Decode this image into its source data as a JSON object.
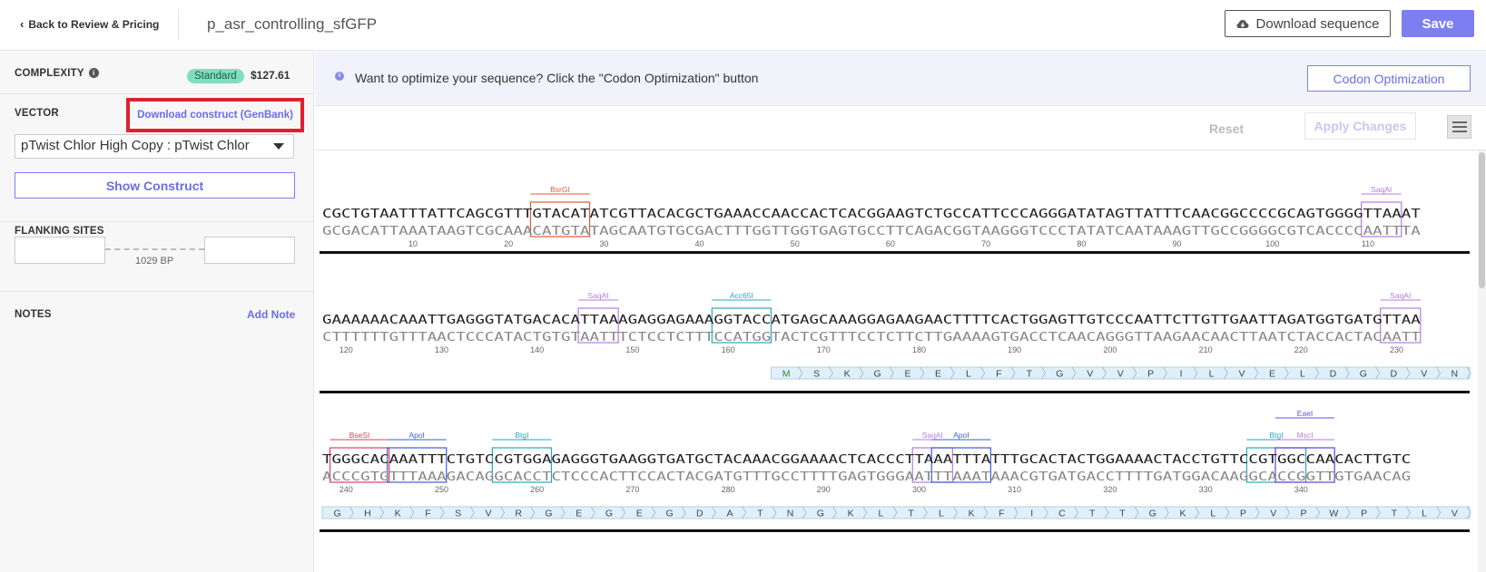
{
  "header": {
    "back_label": "Back to Review & Pricing",
    "sequence_name": "p_asr_controlling_sfGFP",
    "download_label": "Download sequence",
    "save_label": "Save"
  },
  "sidebar": {
    "complexity_label": "COMPLEXITY",
    "complexity_badge": "Standard",
    "price": "$127.61",
    "vector_label": "VECTOR",
    "genbank_link": "Download construct (GenBank)",
    "vector_value": "pTwist Chlor High Copy : pTwist Chlor",
    "show_construct": "Show Construct",
    "flanking_label": "FLANKING SITES",
    "flanking_length": "1029 BP",
    "notes_label": "NOTES",
    "add_note": "Add Note"
  },
  "main": {
    "banner_text": "Want to optimize your sequence? Click the \"Codon Optimization\" button",
    "codon_button": "Codon Optimization",
    "reset": "Reset",
    "apply": "Apply Changes"
  },
  "icons": {
    "info": "info-icon",
    "cloud": "cloud-download-icon",
    "menu": "hamburger-menu-icon",
    "back": "chevron-left-icon"
  },
  "colors": {
    "accent": "#7c7ff0",
    "badge": "#7de0bd",
    "highlight_box": "#e0202f"
  },
  "sequence_rows": [
    {
      "top": "CGCTGTAATTTATTCAGCGTTTGTACATATCGTTACACGCTGAAACCAACCACTCACGGAAGTCTGCCATTCCCAGGGATATAGTTATTTCAACGGCCCCGCAGTGGGGTTAAAT",
      "bottom": "GCGACATTAAATAAGTCGCAAACATGTATAGCAATGTGCGACTTTGGTTGGTGAGTGCCTTCAGACGGTAAGGGTCCCTATATCAATAAAGTTGCCGGGGCGTCACCCCAATTTA",
      "ticks": [
        "10",
        "20",
        "30",
        "40",
        "50",
        "60",
        "70",
        "80",
        "90",
        "100",
        "110"
      ],
      "sites": [
        {
          "name": "BsrGI",
          "start": 22,
          "len": 6,
          "color": "#e05a3a"
        },
        {
          "name": "SaqAI",
          "start": 109,
          "len": 4,
          "color": "#b57be0"
        }
      ],
      "aa": []
    },
    {
      "top": "GAAAAAACAAATTGAGGGTATGACACATTAAAGAGGAGAAAGGTACCATGAGCAAAGGAGAAGAACTTTTCACTGGAGTTGTCCCAATTCTTGTTGAATTAGATGGTGATGTTAA",
      "bottom": "CTTTTTTGTTTAACTCCCATACTGTGTAATTTCTCCTCTTTCCATGGTACTCGTTTCCTCTTCTTGAAAAGTGACCTCAACAGGGTTAAGAACAACTTAATCTACCACTACAATT",
      "ticks": [
        "120",
        "130",
        "140",
        "150",
        "160",
        "170",
        "180",
        "190",
        "200",
        "210",
        "220",
        "230"
      ],
      "sites": [
        {
          "name": "SaqAI",
          "start": 27,
          "len": 4,
          "color": "#b57be0"
        },
        {
          "name": "Acc65I",
          "start": 41,
          "len": 6,
          "color": "#2aa6c0"
        },
        {
          "name": "SaqAI",
          "start": 111,
          "len": 4,
          "color": "#b57be0"
        }
      ],
      "aa": [
        "M",
        "S",
        "K",
        "G",
        "E",
        "E",
        "L",
        "F",
        "T",
        "G",
        "V",
        "V",
        "P",
        "I",
        "L",
        "V",
        "E",
        "L",
        "D",
        "G",
        "D",
        "V",
        "N"
      ]
    },
    {
      "top": "TGGGCACAAATTTCTGTCCGTGGAGAGGGTGAAGGTGATGCTACAAACGGAAAACTCACCCTTAAATTTATTTGCACTACTGGAAAACTACCTGTTCCGTGGCCAACACTTGTC",
      "bottom": "ACCCGTGTTTAAAGACAGGCACCTCTCCCACTTCCACTACGATGTTTGCCTTTTGAGTGGGAATTTAAATAAACGTGATGACCTTTTGATGGACAAGGCACCGGTTGTGAACAG",
      "ticks": [
        "240",
        "250",
        "260",
        "270",
        "280",
        "290",
        "300",
        "310",
        "320",
        "330",
        "340"
      ],
      "sites": [
        {
          "name": "BseSI",
          "start": 1,
          "len": 6,
          "color": "#e0405a"
        },
        {
          "name": "ApoI",
          "start": 7,
          "len": 6,
          "color": "#3a60d0"
        },
        {
          "name": "BtgI",
          "start": 18,
          "len": 6,
          "color": "#2aa6c0"
        },
        {
          "name": "SaqAI",
          "start": 62,
          "len": 4,
          "color": "#b57be0"
        },
        {
          "name": "ApoI",
          "start": 64,
          "len": 6,
          "color": "#3a60d0"
        },
        {
          "name": "BtgI",
          "start": 97,
          "len": 6,
          "color": "#2aa6c0"
        },
        {
          "name": "MscI",
          "start": 100,
          "len": 6,
          "color": "#b57be0"
        },
        {
          "name": "EaeI",
          "start": 100,
          "len": 6,
          "color": "#6a4ee0"
        }
      ],
      "aa": [
        "G",
        "H",
        "K",
        "F",
        "S",
        "V",
        "R",
        "G",
        "E",
        "G",
        "E",
        "G",
        "D",
        "A",
        "T",
        "N",
        "G",
        "K",
        "L",
        "T",
        "L",
        "K",
        "F",
        "I",
        "C",
        "T",
        "T",
        "G",
        "K",
        "L",
        "P",
        "V",
        "P",
        "W",
        "P",
        "T",
        "L",
        "V"
      ]
    }
  ]
}
